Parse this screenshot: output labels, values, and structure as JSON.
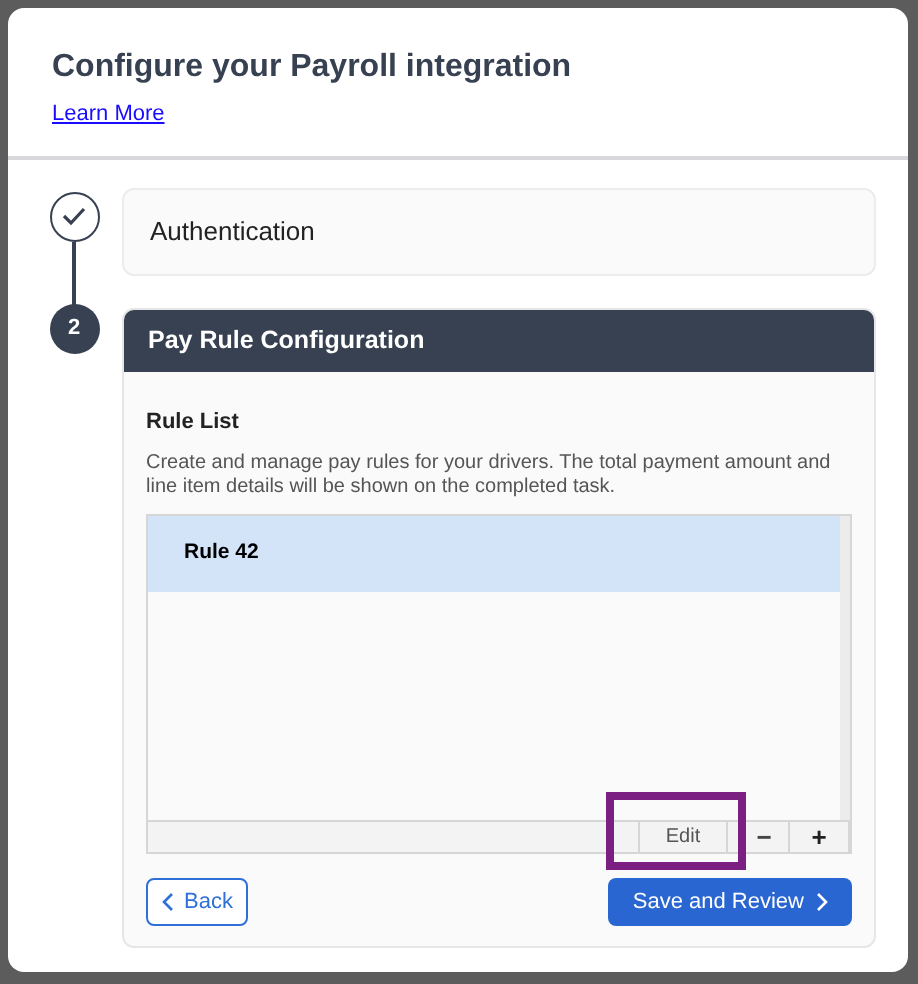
{
  "dialog": {
    "title": "Configure your Payroll integration",
    "link": "Learn More"
  },
  "steps": [
    {
      "kind": "done",
      "title": "Authentication"
    },
    {
      "kind": "current",
      "number": "2",
      "title": "Pay Rule Configuration",
      "section": {
        "heading": "Rule List",
        "description": "Create and manage pay rules for your drivers. The total payment amount and line item details will be shown on the completed task.",
        "rules": [
          {
            "label": "Rule 42",
            "selected": true
          }
        ],
        "toolbar": {
          "edit": "Edit",
          "remove": "−",
          "add": "+"
        },
        "back": "Back",
        "next": "Save and Review"
      }
    }
  ]
}
